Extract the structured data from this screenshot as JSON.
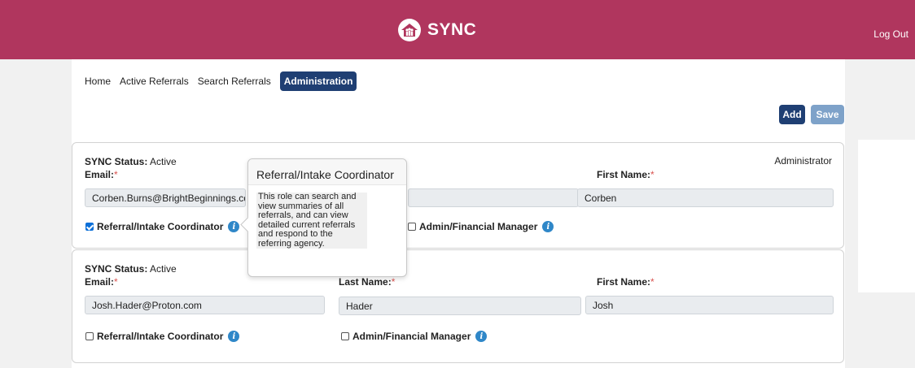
{
  "header": {
    "app_name": "SYNC",
    "logout": "Log Out",
    "color": "#b0365e"
  },
  "nav": {
    "items": [
      "Home",
      "Active Referrals",
      "Search Referrals"
    ],
    "active": "Administration"
  },
  "actions": {
    "add": "Add",
    "save": "Save"
  },
  "labels": {
    "status": "SYNC Status:",
    "email": "Email:",
    "last_name": "Last Name:",
    "first_name": "First Name:",
    "required": "*",
    "role_referral": "Referral/Intake Coordinator",
    "role_admin": "Admin/Financial Manager"
  },
  "users": [
    {
      "status": "Active",
      "role_tag": "Administrator",
      "email": "Corben.Burns@BrightBeginnings.com",
      "last_name": "",
      "first_name": "Corben",
      "referral_checked": true,
      "admin_checked": false
    },
    {
      "status": "Active",
      "role_tag": "",
      "email": "Josh.Hader@Proton.com",
      "last_name": "Hader",
      "first_name": "Josh",
      "referral_checked": false,
      "admin_checked": false
    }
  ],
  "popover": {
    "title": "Referral/Intake Coordinator",
    "body": "This role can search and view summaries of all referrals, and can view detailed current referrals and respond to the referring agency."
  },
  "colors": {
    "primary": "#1f3f73",
    "save_disabled": "#7ea2c9",
    "info": "#2f87c8",
    "required": "#d9534f"
  }
}
